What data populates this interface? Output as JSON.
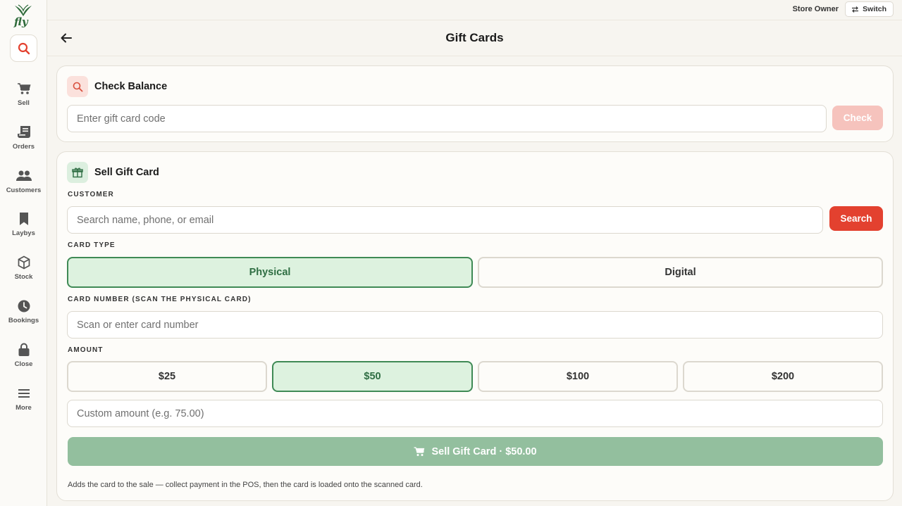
{
  "app": {
    "logo_text": "fly"
  },
  "topbar": {
    "user_role": "Store Owner",
    "switch_label": "Switch"
  },
  "header": {
    "title": "Gift Cards"
  },
  "sidebar": {
    "items": [
      {
        "label": "Sell",
        "icon": "cart-icon"
      },
      {
        "label": "Orders",
        "icon": "orders-icon"
      },
      {
        "label": "Customers",
        "icon": "customers-icon"
      },
      {
        "label": "Laybys",
        "icon": "bookmark-icon"
      },
      {
        "label": "Stock",
        "icon": "box-icon"
      },
      {
        "label": "Bookings",
        "icon": "clock-icon"
      },
      {
        "label": "Close",
        "icon": "lock-icon"
      },
      {
        "label": "More",
        "icon": "menu-icon"
      }
    ]
  },
  "check_balance": {
    "title": "Check Balance",
    "code_placeholder": "Enter gift card code",
    "check_label": "Check"
  },
  "sell_gift_card": {
    "title": "Sell Gift Card",
    "customer_label": "CUSTOMER",
    "customer_placeholder": "Search name, phone, or email",
    "search_label": "Search",
    "card_type_label": "CARD TYPE",
    "card_types": [
      "Physical",
      "Digital"
    ],
    "selected_card_type": "Physical",
    "card_number_label": "CARD NUMBER (SCAN THE PHYSICAL CARD)",
    "card_number_placeholder": "Scan or enter card number",
    "amount_label": "AMOUNT",
    "amounts": [
      "$25",
      "$50",
      "$100",
      "$200"
    ],
    "selected_amount": "$50",
    "custom_amount_placeholder": "Custom amount (e.g. 75.00)",
    "sell_button_label": "Sell Gift Card · $50.00",
    "hint": "Adds the card to the sale — collect payment in the POS, then the card is loaded onto the scanned card."
  },
  "colors": {
    "accent_red": "#e3412f",
    "selected_green_bg": "#ddf2df",
    "selected_green_border": "#3f8a55",
    "sell_button": "#93bf9e"
  }
}
